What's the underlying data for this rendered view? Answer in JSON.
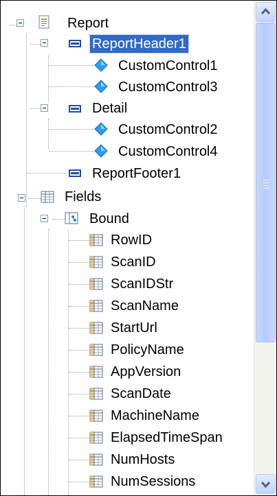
{
  "tree": {
    "report": {
      "label": "Report"
    },
    "report_header": {
      "label": "ReportHeader1"
    },
    "custom_control_1": {
      "label": "CustomControl1"
    },
    "custom_control_3": {
      "label": "CustomControl3"
    },
    "detail": {
      "label": "Detail"
    },
    "custom_control_2": {
      "label": "CustomControl2"
    },
    "custom_control_4": {
      "label": "CustomControl4"
    },
    "report_footer": {
      "label": "ReportFooter1"
    },
    "fields": {
      "label": "Fields"
    },
    "bound": {
      "label": "Bound"
    },
    "bound_fields": [
      "RowID",
      "ScanID",
      "ScanIDStr",
      "ScanName",
      "StartUrl",
      "PolicyName",
      "AppVersion",
      "ScanDate",
      "MachineName",
      "ElapsedTimeSpan",
      "NumHosts",
      "NumSessions"
    ]
  },
  "colors": {
    "selection": "#316ac5",
    "scrollbar_thumb": "#b7ccfb",
    "section_icon": "#1f4f9c",
    "control_icon": "#2a9df4"
  },
  "scrollbar": {
    "visible_fraction": 0.69
  }
}
